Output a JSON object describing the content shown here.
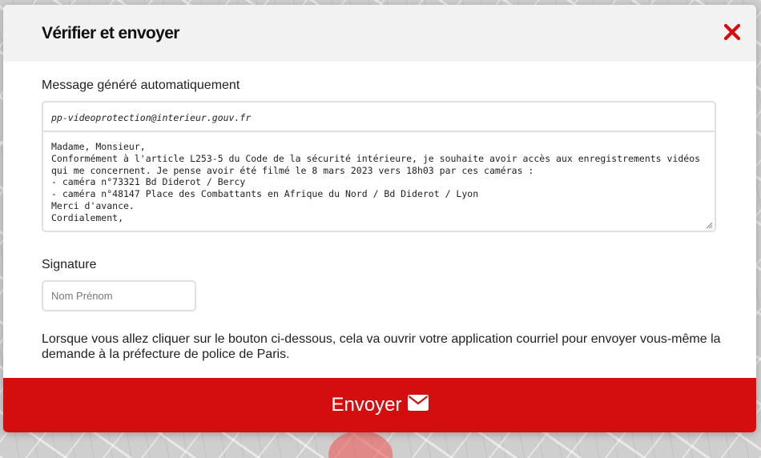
{
  "modal": {
    "title": "Vérifier et envoyer",
    "close_icon": "close-x-icon",
    "accent_color": "#d40e0e"
  },
  "message": {
    "label": "Message généré automatiquement",
    "recipient": "pp-videoprotection@interieur.gouv.fr",
    "body": "Madame, Monsieur,\nConformément à l'article L253-5 du Code de la sécurité intérieure, je souhaite avoir accès aux enregistrements vidéos qui me concernent. Je pense avoir été filmé le 8 mars 2023 vers 18h03 par ces caméras :\n- caméra n°73321 Bd Diderot / Bercy\n- caméra n°48147 Place des Combattants en Afrique du Nord / Bd Diderot / Lyon\nMerci d'avance.\nCordialement,"
  },
  "signature": {
    "label": "Signature",
    "placeholder": "Nom Prénom",
    "value": ""
  },
  "info": {
    "text": "Lorsque vous allez cliquer sur le bouton ci-dessous, cela va ouvrir votre application courriel pour envoyer vous-même la demande à la préfecture de police de Paris."
  },
  "send": {
    "label": "Envoyer",
    "icon": "envelope-icon"
  }
}
